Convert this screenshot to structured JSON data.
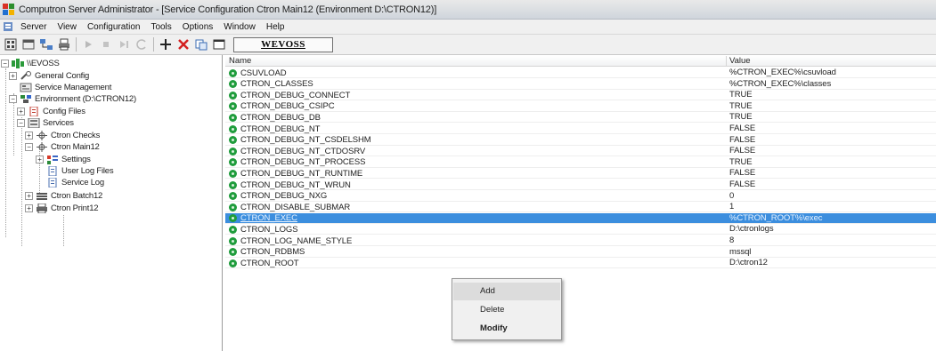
{
  "window": {
    "title": "Computron Server Administrator - [Service Configuration Ctron Main12 (Environment D:\\CTRON12)]"
  },
  "menubar": {
    "items": [
      "Server",
      "View",
      "Configuration",
      "Tools",
      "Options",
      "Window",
      "Help"
    ]
  },
  "toolbar": {
    "server_name": "WEVOSS"
  },
  "tree": {
    "root": "\\\\EVOSS",
    "general_config": "General Config",
    "service_management": "Service Management",
    "environment": "Environment (D:\\CTRON12)",
    "config_files": "Config Files",
    "services": "Services",
    "ctron_checks": "Ctron Checks",
    "ctron_main12": "Ctron Main12",
    "settings": "Settings",
    "user_log_files": "User Log Files",
    "service_log": "Service Log",
    "ctron_batch12": "Ctron Batch12",
    "ctron_print12": "Ctron Print12"
  },
  "grid": {
    "columns": [
      "Name",
      "Value"
    ],
    "rows": [
      {
        "name": "CSUVLOAD",
        "value": "%CTRON_EXEC%\\csuvload"
      },
      {
        "name": "CTRON_CLASSES",
        "value": "%CTRON_EXEC%\\classes"
      },
      {
        "name": "CTRON_DEBUG_CONNECT",
        "value": "TRUE"
      },
      {
        "name": "CTRON_DEBUG_CSIPC",
        "value": "TRUE"
      },
      {
        "name": "CTRON_DEBUG_DB",
        "value": "TRUE"
      },
      {
        "name": "CTRON_DEBUG_NT",
        "value": "FALSE"
      },
      {
        "name": "CTRON_DEBUG_NT_CSDELSHM",
        "value": "FALSE"
      },
      {
        "name": "CTRON_DEBUG_NT_CTDOSRV",
        "value": "FALSE"
      },
      {
        "name": "CTRON_DEBUG_NT_PROCESS",
        "value": "TRUE"
      },
      {
        "name": "CTRON_DEBUG_NT_RUNTIME",
        "value": "FALSE"
      },
      {
        "name": "CTRON_DEBUG_NT_WRUN",
        "value": "FALSE"
      },
      {
        "name": "CTRON_DEBUG_NXG",
        "value": "0"
      },
      {
        "name": "CTRON_DISABLE_SUBMAR",
        "value": "1"
      },
      {
        "name": "CTRON_EXEC",
        "value": "%CTRON_ROOT%\\exec"
      },
      {
        "name": "CTRON_LOGS",
        "value": "D:\\ctronlogs"
      },
      {
        "name": "CTRON_LOG_NAME_STYLE",
        "value": "8"
      },
      {
        "name": "CTRON_RDBMS",
        "value": "mssql"
      },
      {
        "name": "CTRON_ROOT",
        "value": "D:\\ctron12"
      }
    ],
    "selected_row": 13
  },
  "context_menu": {
    "add": "Add",
    "delete": "Delete",
    "modify": "Modify"
  },
  "colors": {
    "selection": "#3c8ede",
    "gear_green": "#1f9c3c"
  }
}
